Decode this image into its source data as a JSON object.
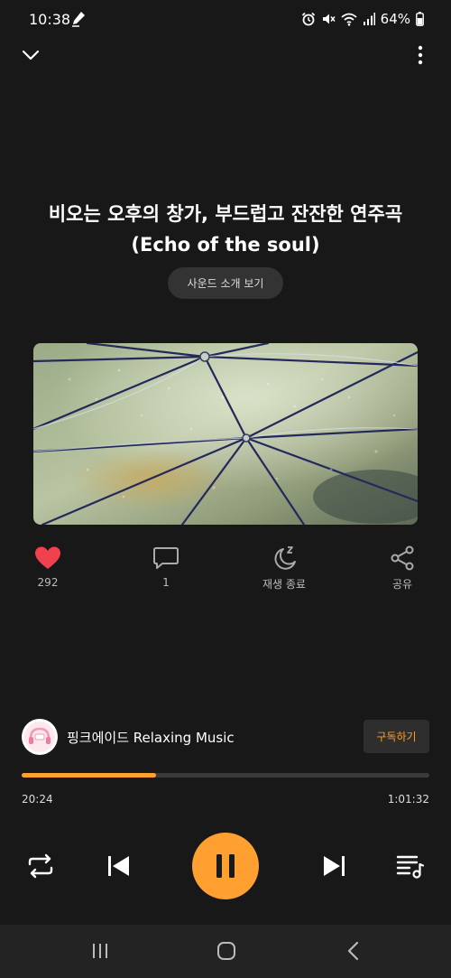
{
  "status_bar": {
    "time": "10:38",
    "battery": "64%",
    "icons": [
      "edit-icon",
      "alarm-icon",
      "mute-icon",
      "wifi-icon",
      "signal-icon",
      "battery-icon"
    ]
  },
  "header": {
    "collapse_icon": "chevron-down-icon",
    "more_icon": "more-vertical-icon"
  },
  "track": {
    "title": "비오는 오후의 창가, 부드럽고 잔잔한 연주곡 (Echo of the soul)",
    "intro_button": "사운드 소개 보기"
  },
  "actions": {
    "like_count": "292",
    "comment_count": "1",
    "sleep_label": "재생 종료",
    "share_label": "공유"
  },
  "channel": {
    "name": "핑크에이드 Relaxing Music",
    "subscribe_label": "구독하기"
  },
  "player": {
    "elapsed": "20:24",
    "total": "1:01:32",
    "progress_fraction": 0.33
  },
  "colors": {
    "accent": "#ffa030",
    "background": "#181818",
    "heart": "#f0414f"
  }
}
